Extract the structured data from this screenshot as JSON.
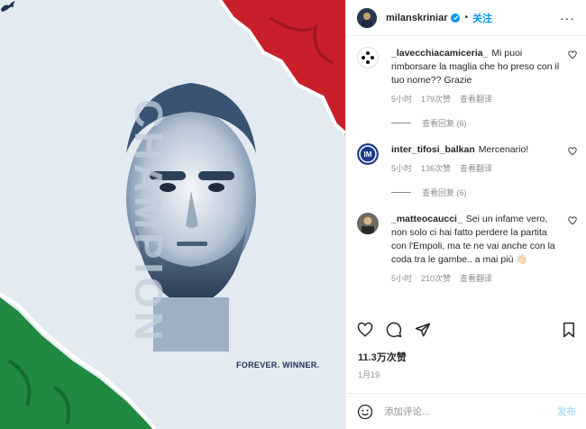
{
  "post": {
    "username": "milanskriniar",
    "follow_label": "关注",
    "dot": "•",
    "more_label": "···",
    "image": {
      "footer_text": "FOREVER. WINNER.",
      "vertical_word": "CHAMPION",
      "colors": {
        "green": "#1f9a47",
        "red": "#d0232a",
        "paper": "#e8eef3",
        "navy": "#1d3354"
      }
    }
  },
  "comments": [
    {
      "username": "_lavecchiacamiceria_",
      "text": "Mi puoi rimborsare la maglia che ho preso con il tuo nome?? Grazie",
      "time": "5小时",
      "likes": "179次赞",
      "reply_label": "查看翻译",
      "view_replies": "查看回复 (6)"
    },
    {
      "username": "inter_tifosi_balkan",
      "text": "Mercenario!",
      "time": "5小时",
      "likes": "136次赞",
      "reply_label": "查看翻译",
      "view_replies": "查看回复 (6)"
    },
    {
      "username": "_matteocaucci_",
      "text": "Sei un infame vero, non solo ci hai fatto perdere la partita con l'Empoli, ma te ne vai anche con la coda tra le gambe.. a mai più 👋🏻",
      "time": "5小时",
      "likes": "210次赞",
      "reply_label": "查看翻译"
    }
  ],
  "summary": {
    "likes": "11.3万次赞",
    "date": "1月19"
  },
  "composer": {
    "placeholder": "添加评论...",
    "post_label": "发布"
  },
  "accent": "#0095f6"
}
